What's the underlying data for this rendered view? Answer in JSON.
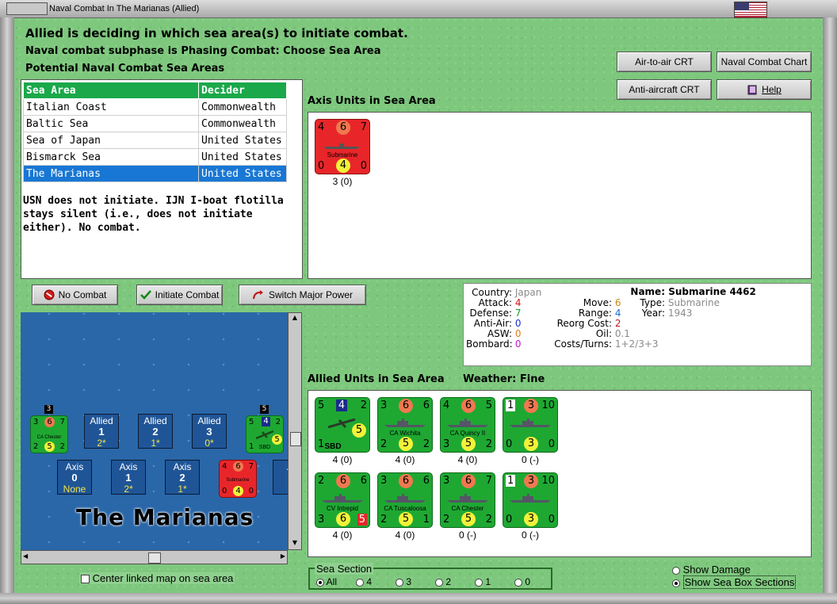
{
  "window": {
    "title": "Naval Combat In The Marianas (Allied)"
  },
  "header": {
    "line1": "Allied is deciding in which sea area(s) to initiate combat.",
    "line2": "Naval combat subphase is Phasing Combat: Choose Sea Area",
    "line3": "Potential Naval Combat Sea Areas"
  },
  "buttons": {
    "air_to_air": "Air-to-air CRT",
    "naval_chart": "Naval Combat Chart",
    "anti_aircraft": "Anti-aircraft CRT",
    "help": "Help",
    "no_combat": "No Combat",
    "initiate": "Initiate Combat",
    "switch": "Switch Major Power"
  },
  "sea_table": {
    "headers": [
      "Sea Area",
      "Decider"
    ],
    "rows": [
      [
        "Italian Coast",
        "Commonwealth"
      ],
      [
        "Baltic Sea",
        "Commonwealth"
      ],
      [
        "Sea of Japan",
        "United States"
      ],
      [
        "Bismarck Sea",
        "United States"
      ],
      [
        "The Marianas",
        "United States"
      ]
    ],
    "note": "USN does not initiate.  IJN I-boat flotilla stays silent (i.e., does not initiate either). No combat."
  },
  "axis_panel": {
    "title": "Axis Units in Sea Area",
    "units": [
      {
        "tl": "4",
        "circ_top": "6",
        "tr": "7",
        "name": "Submarine",
        "bl": "0",
        "circ_bot": "4",
        "br": "0",
        "label": "3 (0)"
      }
    ]
  },
  "stats": {
    "country_lbl": "Country:",
    "country": "Japan",
    "attack_lbl": "Attack:",
    "attack": "4",
    "defense_lbl": "Defense:",
    "defense": "7",
    "antiair_lbl": "Anti-Air:",
    "antiair": "0",
    "asw_lbl": "ASW:",
    "asw": "0",
    "bombard_lbl": "Bombard:",
    "bombard": "0",
    "move_lbl": "Move:",
    "move": "6",
    "range_lbl": "Range:",
    "range": "4",
    "reorg_lbl": "Reorg Cost:",
    "reorg": "2",
    "oil_lbl": "Oil:",
    "oil": "0.1",
    "costs_lbl": "Costs/Turns:",
    "costs": "1+2/3+3",
    "name_lbl": "Name:",
    "name": "Submarine 4462",
    "type_lbl": "Type:",
    "type": "Submarine",
    "year_lbl": "Year:",
    "year": "1943"
  },
  "allied_panel": {
    "title": "Allied Units in Sea Area",
    "weather_lbl": "Weather:",
    "weather": "Fine",
    "units": [
      {
        "tl": "5",
        "circ_top": "4",
        "tr": "2",
        "name": "SBD",
        "bl": "1",
        "circ_bot": "5",
        "br": "",
        "label": "4 (0)"
      },
      {
        "tl": "3",
        "circ_top": "6",
        "tr": "6",
        "name": "CA Wichita",
        "bl": "2",
        "circ_bot": "5",
        "br": "2",
        "label": "4 (0)"
      },
      {
        "tl": "4",
        "circ_top": "6",
        "tr": "5",
        "name": "CA Quincy II",
        "bl": "3",
        "circ_bot": "5",
        "br": "2",
        "label": "4 (0)"
      },
      {
        "tl": "1",
        "circ_top": "3",
        "tr": "10",
        "name": "",
        "bl": "0",
        "circ_bot": "3",
        "br": "0",
        "label": "0 (-)"
      },
      {
        "tl": "2",
        "circ_top": "6",
        "tr": "6",
        "name": "CV Intrepid",
        "bl": "3",
        "circ_bot": "6",
        "br": "5",
        "label": "4 (0)"
      },
      {
        "tl": "3",
        "circ_top": "6",
        "tr": "6",
        "name": "CA Tuscaloosa",
        "bl": "2",
        "circ_bot": "5",
        "br": "1",
        "label": "4 (0)"
      },
      {
        "tl": "3",
        "circ_top": "6",
        "tr": "7",
        "name": "CA Chester",
        "bl": "2",
        "circ_bot": "5",
        "br": "2",
        "label": "0 (-)"
      },
      {
        "tl": "1",
        "circ_top": "3",
        "tr": "10",
        "name": "",
        "bl": "0",
        "circ_bot": "3",
        "br": "0",
        "label": "0 (-)"
      }
    ]
  },
  "map": {
    "name": "The Marianas",
    "allied_boxes": [
      {
        "side": "Allied",
        "num": "1",
        "sub": "2*"
      },
      {
        "side": "Allied",
        "num": "2",
        "sub": "1*"
      },
      {
        "side": "Allied",
        "num": "3",
        "sub": "0*"
      }
    ],
    "axis_boxes": [
      {
        "side": "Axis",
        "num": "0",
        "sub": "None"
      },
      {
        "side": "Axis",
        "num": "1",
        "sub": "2*"
      },
      {
        "side": "Axis",
        "num": "2",
        "sub": "1*"
      },
      {
        "side": "A",
        "num": "",
        "sub": ""
      }
    ],
    "counters": {
      "chester": {
        "badge": "3",
        "tl": "3",
        "circ_top": "6",
        "tr": "7",
        "name": "CA Chester",
        "bl": "2",
        "circ_bot": "5",
        "br": "2"
      },
      "sbd": {
        "badge": "5",
        "tl": "5",
        "circ_top": "4",
        "tr": "2",
        "name": "SBD",
        "bl": "1",
        "circ_bot": "5",
        "br": ""
      },
      "sub": {
        "tl": "4",
        "circ_top": "6",
        "tr": "7",
        "name": "Submarine",
        "bl": "0",
        "circ_bot": "4",
        "br": "0"
      }
    }
  },
  "footer": {
    "center_map": "Center linked map on sea area",
    "sea_section": "Sea Section",
    "sections": [
      "All",
      "4",
      "3",
      "2",
      "1",
      "0"
    ],
    "show_damage": "Show Damage",
    "show_sea_box": "Show Sea Box Sections"
  }
}
